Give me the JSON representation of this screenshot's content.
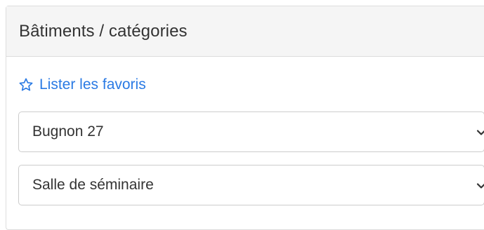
{
  "panel": {
    "title": "Bâtiments / catégories",
    "favorites_link": {
      "label": "Lister les favoris",
      "icon": "star-outline-icon",
      "color": "#2a7ae4"
    },
    "building_select": {
      "selected": "Bugnon 27",
      "icon": "chevron-down-icon"
    },
    "category_select": {
      "selected": "Salle de séminaire",
      "icon": "chevron-down-icon"
    }
  }
}
